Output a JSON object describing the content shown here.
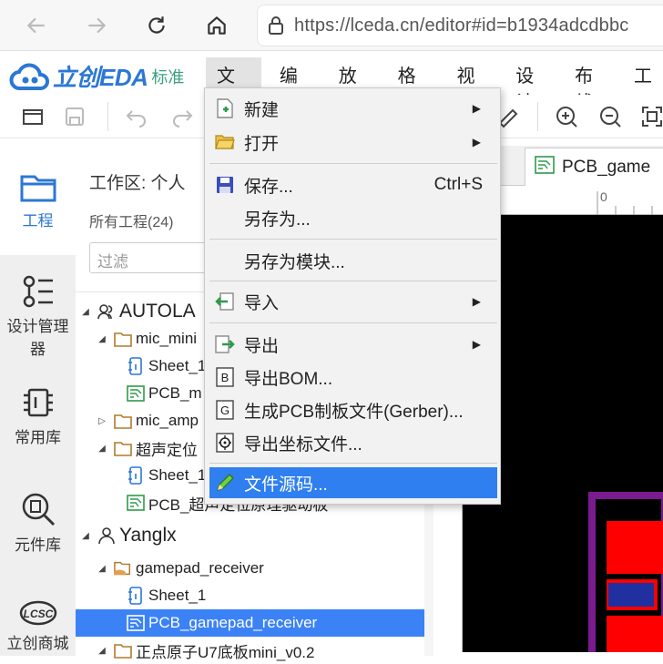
{
  "browser": {
    "url": "https://lceda.cn/editor#id=b1934adcdbbc"
  },
  "app": {
    "logo_text": "立创EDA",
    "edition": "标准",
    "menus": [
      "文件",
      "编辑",
      "放置",
      "格式",
      "视图",
      "设计",
      "布线",
      "工"
    ]
  },
  "rail": {
    "items": [
      {
        "label": "工程",
        "icon": "folder-icon"
      },
      {
        "label": "设计管理器",
        "icon": "design-manager-icon"
      },
      {
        "label": "常用库",
        "icon": "chip-icon"
      },
      {
        "label": "元件库",
        "icon": "component-search-icon"
      },
      {
        "label": "立创商城",
        "icon": "lcsc-logo"
      }
    ],
    "lcsc_text": "LCSC"
  },
  "panel": {
    "workspace_title": "工作区: 个人",
    "project_count": "所有工程(24)",
    "filter_placeholder": "过滤",
    "tree": [
      {
        "label": "AUTOLA",
        "type": "user"
      },
      {
        "label": "mic_mini",
        "type": "folder"
      },
      {
        "label": "Sheet_1",
        "type": "sheet"
      },
      {
        "label": "PCB_m",
        "type": "pcb"
      },
      {
        "label": "mic_amp",
        "type": "folder"
      },
      {
        "label": "超声定位",
        "type": "folder"
      },
      {
        "label": "Sheet_1",
        "type": "sheet"
      },
      {
        "label": "PCB_超声定位原理驱动板",
        "type": "pcb"
      },
      {
        "label": "Yanglx",
        "type": "user"
      },
      {
        "label": "gamepad_receiver",
        "type": "folder"
      },
      {
        "label": "Sheet_1",
        "type": "sheet"
      },
      {
        "label": "PCB_gamepad_receiver",
        "type": "pcb"
      },
      {
        "label": "正点原子U7底板mini_v0.2",
        "type": "folder"
      }
    ]
  },
  "document": {
    "tab_label": "PCB_game",
    "ruler_zero": "0"
  },
  "file_menu": {
    "items": [
      {
        "label": "新建",
        "icon": "new-file-icon",
        "submenu": true
      },
      {
        "label": "打开",
        "icon": "open-folder-icon",
        "submenu": true
      },
      {
        "label": "保存...",
        "icon": "save-icon",
        "shortcut": "Ctrl+S"
      },
      {
        "label": "另存为...",
        "icon": ""
      },
      {
        "label": "另存为模块...",
        "icon": ""
      },
      {
        "label": "导入",
        "icon": "import-icon",
        "submenu": true
      },
      {
        "label": "导出",
        "icon": "export-icon",
        "submenu": true
      },
      {
        "label": "导出BOM...",
        "icon": "bom-icon",
        "badge": "B"
      },
      {
        "label": "生成PCB制板文件(Gerber)...",
        "icon": "gerber-icon",
        "badge": "G"
      },
      {
        "label": "导出坐标文件...",
        "icon": "coordinate-icon"
      },
      {
        "label": "文件源码...",
        "icon": "source-code-icon",
        "highlighted": true
      }
    ]
  },
  "colors": {
    "accent": "#2f7ff0",
    "selection": "#3b82f6",
    "logo": "#2b77d6"
  }
}
